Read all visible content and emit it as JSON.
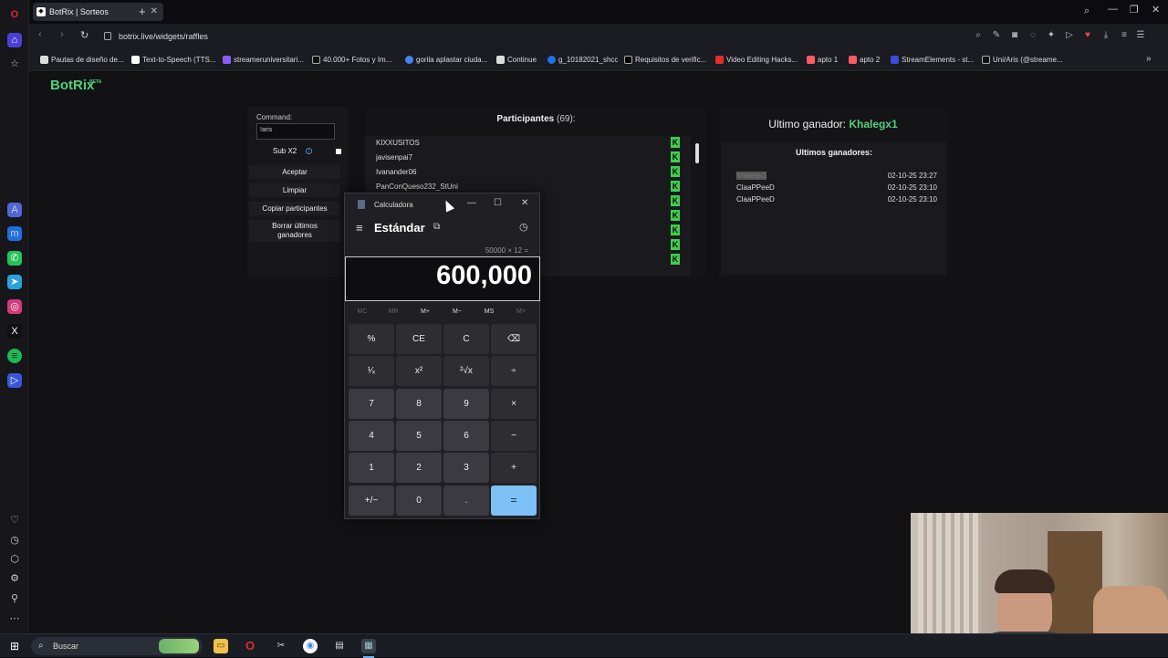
{
  "browser": {
    "tab_title": "BotRix | Sorteos",
    "url": "botrix.live/widgets/raffles",
    "bookmarks": [
      "Pautas de diseño de...",
      "Text-to-Speech (TTS...",
      "streameruniversitari...",
      "40.000+ Fotos y Im...",
      "gorila aplastar ciuda...",
      "Continue",
      "g_10182021_shcc",
      "Requisitos de verific...",
      "Video Editing Hacks...",
      "apto 1",
      "apto 2",
      "StreamElements - st...",
      "Uni/Aris (@streame..."
    ]
  },
  "page": {
    "logo": "BotRix",
    "logo_badge": "BETA",
    "command_label": "Command:",
    "command_value": "!aris",
    "sub_label": "Sub X2",
    "buttons": [
      "Aceptar",
      "Limpiar",
      "Copiar participantes",
      "Borrar últimos ganadores"
    ],
    "participants_title": "Participantes",
    "participants_count": "(69):",
    "participants": [
      "KIXXUSITOS",
      "javisenpai7",
      "Ivanander06",
      "PanConQueso232_StUni"
    ],
    "last_winner_label": "Ultimo ganador:",
    "last_winner_name": "Khalegx1",
    "recent_winners_title": "Ultimos ganadores:",
    "recent_winners": [
      {
        "name": "Khalegx1",
        "date": "02-10-25 23:27"
      },
      {
        "name": "ClaaPPeeD",
        "date": "02-10-25 23:10"
      },
      {
        "name": "ClaaPPeeD",
        "date": "02-10-25 23:10"
      }
    ]
  },
  "calculator": {
    "title": "Calculadora",
    "mode": "Estándar",
    "expression": "50000 × 12 =",
    "display": "600,000",
    "memory": [
      "MC",
      "MR",
      "M+",
      "M−",
      "MS",
      "M˅"
    ],
    "keys": [
      [
        "%",
        "CE",
        "C",
        "⌫"
      ],
      [
        "¹⁄ₓ",
        "x²",
        "²√x",
        "÷"
      ],
      [
        "7",
        "8",
        "9",
        "×"
      ],
      [
        "4",
        "5",
        "6",
        "−"
      ],
      [
        "1",
        "2",
        "3",
        "+"
      ],
      [
        "+/−",
        "0",
        ".",
        "="
      ]
    ]
  },
  "taskbar": {
    "search_placeholder": "Buscar"
  }
}
